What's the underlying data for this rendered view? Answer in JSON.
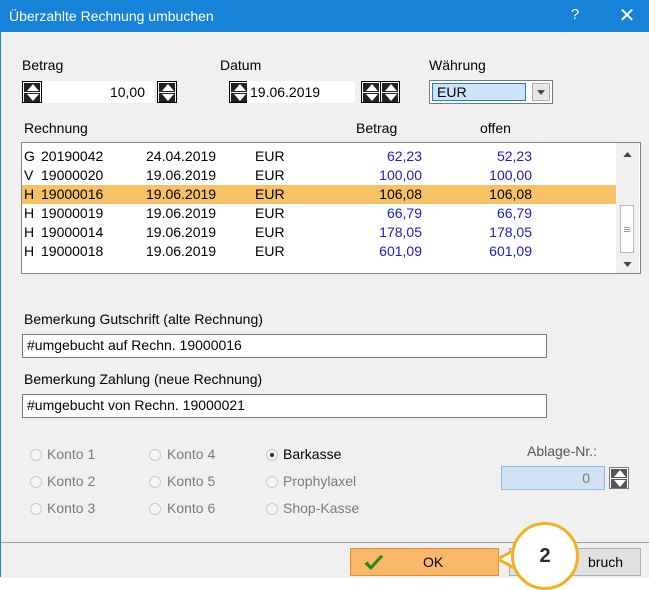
{
  "window": {
    "title": "Überzahlte Rechnung umbuchen",
    "help_label": "?",
    "close_label": "✕"
  },
  "header": {
    "betrag_label": "Betrag",
    "betrag_value": "10,00",
    "datum_label": "Datum",
    "datum_value": "19.06.2019",
    "waehrung_label": "Währung",
    "waehrung_value": "EUR"
  },
  "invoice_list": {
    "headers": {
      "rechnung": "Rechnung",
      "betrag": "Betrag",
      "offen": "offen"
    },
    "rows": [
      {
        "type": "G",
        "nr": "20190042",
        "date": "24.04.2019",
        "cur": "EUR",
        "betrag": "62,23",
        "offen": "52,23",
        "selected": false
      },
      {
        "type": "V",
        "nr": "19000020",
        "date": "19.06.2019",
        "cur": "EUR",
        "betrag": "100,00",
        "offen": "100,00",
        "selected": false
      },
      {
        "type": "H",
        "nr": "19000016",
        "date": "19.06.2019",
        "cur": "EUR",
        "betrag": "106,08",
        "offen": "106,08",
        "selected": true
      },
      {
        "type": "H",
        "nr": "19000019",
        "date": "19.06.2019",
        "cur": "EUR",
        "betrag": "66,79",
        "offen": "66,79",
        "selected": false
      },
      {
        "type": "H",
        "nr": "19000014",
        "date": "19.06.2019",
        "cur": "EUR",
        "betrag": "178,05",
        "offen": "178,05",
        "selected": false
      },
      {
        "type": "H",
        "nr": "19000018",
        "date": "19.06.2019",
        "cur": "EUR",
        "betrag": "601,09",
        "offen": "601,09",
        "selected": false
      }
    ]
  },
  "remarks": {
    "gutschrift_label": "Bemerkung Gutschrift (alte Rechnung)",
    "gutschrift_value": "#umgebucht auf Rechn. 19000016",
    "zahlung_label": "Bemerkung Zahlung (neue Rechnung)",
    "zahlung_value": "#umgebucht von Rechn. 19000021"
  },
  "accounts": {
    "col1": [
      "Konto 1",
      "Konto 2",
      "Konto 3"
    ],
    "col2": [
      "Konto 4",
      "Konto 5",
      "Konto 6"
    ],
    "col3": [
      "Barkasse",
      "Prophylaxel",
      "Shop-Kasse"
    ],
    "selected": "Barkasse"
  },
  "ablage": {
    "label": "Ablage-Nr.:",
    "value": "0"
  },
  "buttons": {
    "ok_label": "OK",
    "cancel_label": "bruch"
  },
  "callout": {
    "number": "2"
  },
  "colors": {
    "titlebar": "#1683d8",
    "selected_row": "#f7c265",
    "ok_button": "#f9b869",
    "amount_text": "#1c1cc4",
    "callout_ring": "#f5b021"
  }
}
